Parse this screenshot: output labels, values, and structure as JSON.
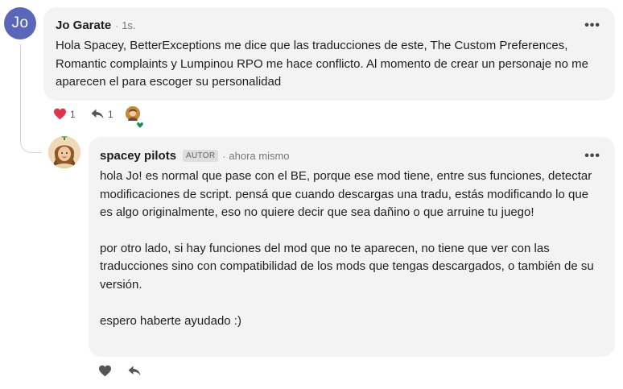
{
  "colors": {
    "bubble_bg": "#f3f3f3",
    "avatar_bg": "#5a67b8",
    "like_active": "#e0344e",
    "badge_bg": "#dedede"
  },
  "comment1": {
    "avatar_initials": "Jo",
    "author": "Jo Garate",
    "separator": "·",
    "time": "1s.",
    "more_label": "•••",
    "body": "Hola Spacey, BetterExceptions me dice que las traducciones de este, The Custom Preferences, Romantic complaints y Lumpinou RPO me hace conflicto. Al momento de crear un personaje no me aparecen el para escoger su personalidad",
    "like_count": "1",
    "reply_count": "1",
    "icons": {
      "like": "heart-filled-icon",
      "reply": "reply-arrow-icon",
      "reactor": "reactor-avatar-icon"
    }
  },
  "comment2": {
    "author": "spacey pilots",
    "badge": "AUTOR",
    "separator": "·",
    "time": "ahora mismo",
    "more_label": "•••",
    "paragraphs": [
      "hola Jo! es normal que pase con el BE, porque ese mod tiene, entre sus funciones, detectar modificaciones de script. pensá que cuando descargas una tradu, estás modificando lo que es algo originalmente, eso no quiere decir que sea dañino o que arruine tu juego!",
      "por otro lado, si hay funciones del mod que no te aparecen, no tiene que ver con las traducciones sino con compatibilidad de los mods que tengas descargados, o también de su versión.",
      "espero haberte ayudado :)"
    ],
    "icons": {
      "like": "heart-outline-icon",
      "reply": "reply-arrow-icon"
    }
  }
}
